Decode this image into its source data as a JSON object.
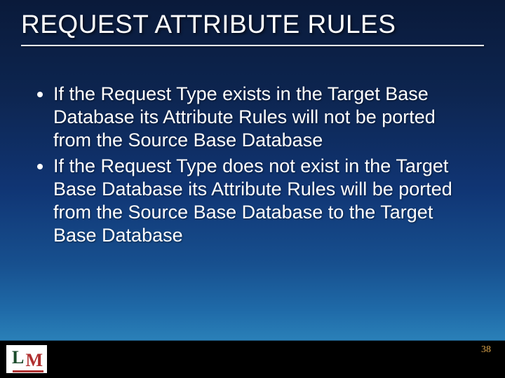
{
  "title": "REQUEST ATTRIBUTE RULES",
  "bullets": [
    "If the Request Type exists in the Target Base Database its Attribute Rules will not be ported from the Source Base Database",
    "If the Request Type does not exist in the Target Base Database its Attribute Rules will be ported from the Source Base Database to the Target Base Database"
  ],
  "page_number": "38",
  "logo": {
    "l": "L",
    "m": "M"
  }
}
